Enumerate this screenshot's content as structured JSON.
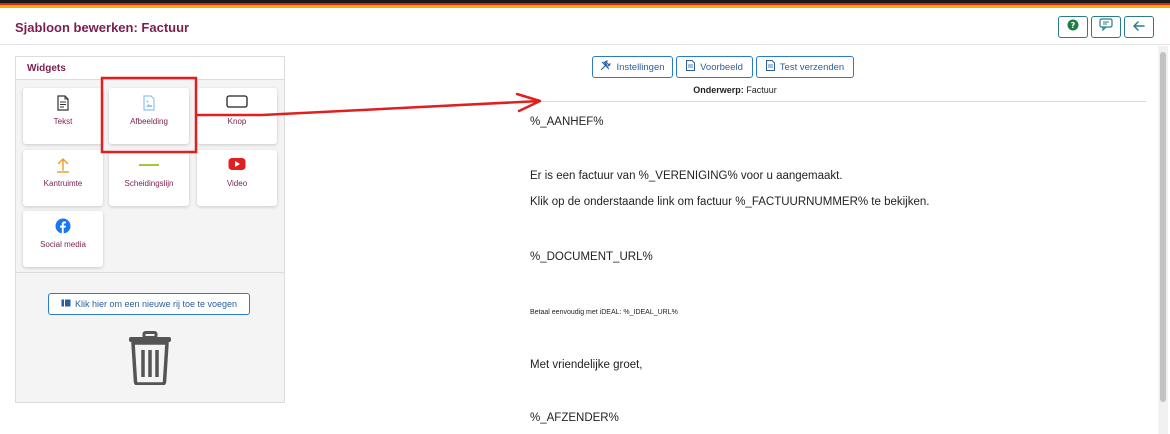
{
  "header": {
    "title": "Sjabloon bewerken: Factuur",
    "buttons": [
      {
        "name": "help",
        "icon": "question-circle-icon"
      },
      {
        "name": "feedback",
        "icon": "feedback-icon"
      },
      {
        "name": "back",
        "icon": "arrow-left-icon"
      }
    ]
  },
  "widgets": {
    "title": "Widgets",
    "items": [
      {
        "label": "Tekst",
        "icon": "document-icon"
      },
      {
        "label": "Afbeelding",
        "icon": "image-file-icon"
      },
      {
        "label": "Knop",
        "icon": "button-outline-icon"
      },
      {
        "label": "Kantruimte",
        "icon": "upload-arrow-icon"
      },
      {
        "label": "Scheidingslijn",
        "icon": "horizontal-line-icon"
      },
      {
        "label": "Video",
        "icon": "youtube-icon"
      },
      {
        "label": "Social media",
        "icon": "facebook-icon"
      }
    ],
    "add_row_label": "Klik hier om een nieuwe rij toe te voegen"
  },
  "toolbar": {
    "settings_label": "Instellingen",
    "preview_label": "Voorbeeld",
    "test_label": "Test verzenden"
  },
  "subject": {
    "label": "Onderwerp:",
    "value": "Factuur"
  },
  "email_body": {
    "greeting": "%_AANHEF%",
    "line1": "Er is een factuur van %_VERENIGING% voor u aangemaakt.",
    "line2": "Klik op de onderstaande link om factuur %_FACTUURNUMMER% te bekijken.",
    "document_url": "%_DOCUMENT_URL%",
    "ideal_line": "Betaal eenvoudig met iDEAL: %_IDEAL_URL%",
    "closing": "Met vriendelijke groet,",
    "sender": "%_AFZENDER%"
  },
  "colors": {
    "title": "#7a1f4f",
    "primary_button": "#2a7cc7",
    "header_button": "#2a7c8a",
    "annotation": "#e02020",
    "help_icon": "#1e7d46"
  }
}
